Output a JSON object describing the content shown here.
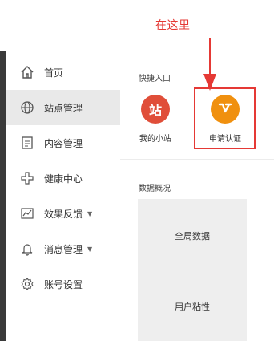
{
  "annotation": {
    "text": "在这里",
    "color": "#e53935"
  },
  "sidebar": {
    "items": [
      {
        "label": "首页",
        "icon": "home-icon"
      },
      {
        "label": "站点管理",
        "icon": "globe-icon"
      },
      {
        "label": "内容管理",
        "icon": "document-icon"
      },
      {
        "label": "健康中心",
        "icon": "plus-icon"
      },
      {
        "label": "效果反馈",
        "icon": "chart-icon",
        "dropdown": true
      },
      {
        "label": "消息管理",
        "icon": "bell-icon",
        "dropdown": true
      },
      {
        "label": "账号设置",
        "icon": "gear-icon"
      }
    ],
    "caret": "▼"
  },
  "main": {
    "quick_access_title": "快捷入口",
    "shortcuts": [
      {
        "label": "我的小站",
        "icon_text": "站",
        "color": "#e04e39",
        "icon": "site-icon"
      },
      {
        "label": "申请认证",
        "icon_text": "V",
        "color": "#f0900f",
        "icon": "verify-icon"
      }
    ],
    "data_overview_title": "数据概况",
    "cards": [
      {
        "label": "全局数据"
      },
      {
        "label": "用户粘性"
      }
    ]
  }
}
